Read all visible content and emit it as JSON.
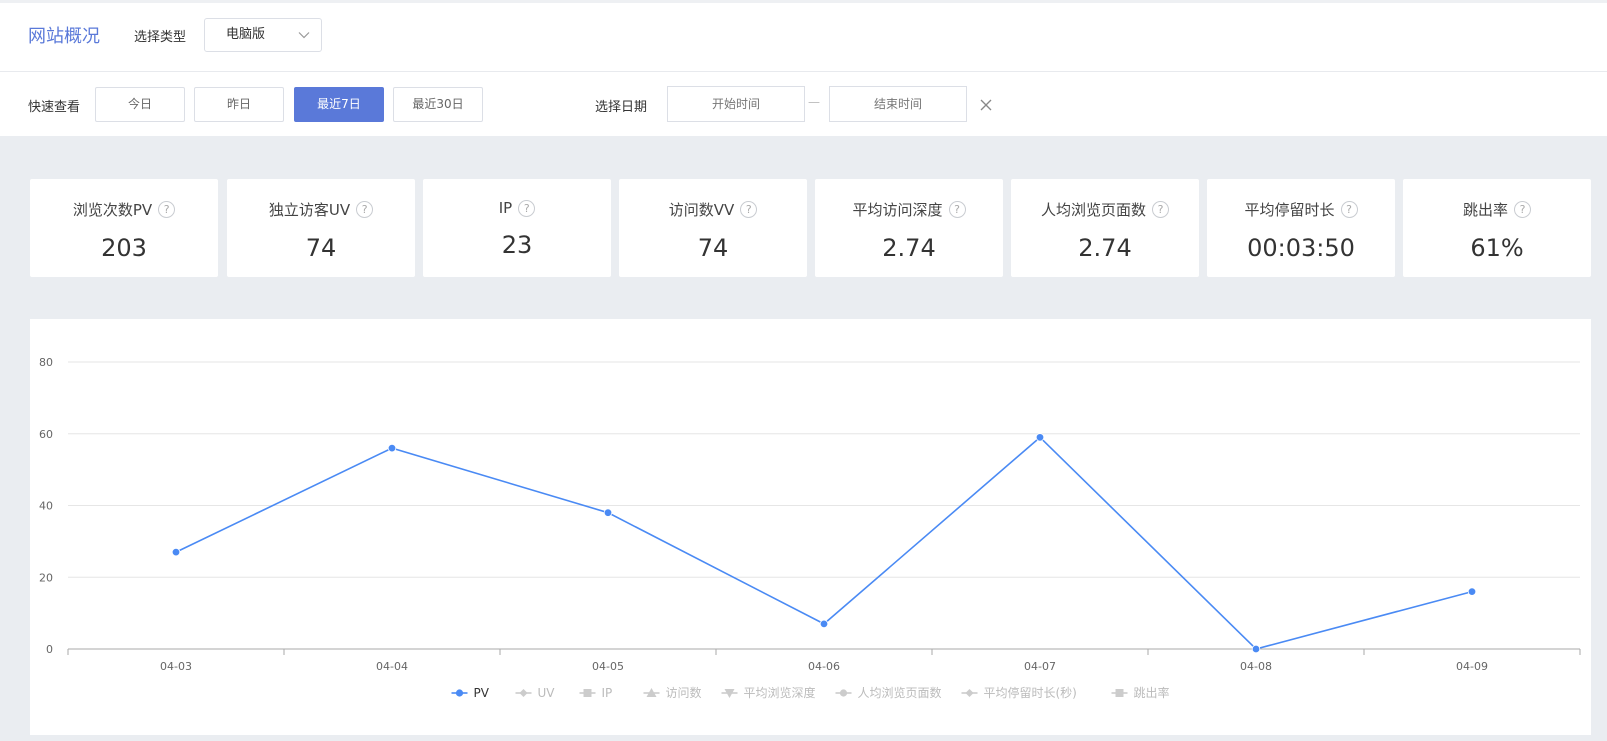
{
  "header": {
    "title": "网站概况",
    "type_label": "选择类型",
    "type_value": "电脑版"
  },
  "filter": {
    "quick_label": "快速查看",
    "buttons": [
      "今日",
      "昨日",
      "最近7日",
      "最近30日"
    ],
    "active_index": 2,
    "date_label": "选择日期",
    "start_placeholder": "开始时间",
    "end_placeholder": "结束时间",
    "separator": "—"
  },
  "stats": [
    {
      "label": "浏览次数PV",
      "value": "203"
    },
    {
      "label": "独立访客UV",
      "value": "74"
    },
    {
      "label": "IP",
      "value": "23"
    },
    {
      "label": "访问数VV",
      "value": "74"
    },
    {
      "label": "平均访问深度",
      "value": "2.74"
    },
    {
      "label": "人均浏览页面数",
      "value": "2.74"
    },
    {
      "label": "平均停留时长",
      "value": "00:03:50"
    },
    {
      "label": "跳出率",
      "value": "61%"
    }
  ],
  "help_symbol": "?",
  "colors": {
    "accent": "#5a79d9",
    "line": "#4a8af4",
    "legend_inactive": "#cccccc"
  },
  "chart_data": {
    "type": "line",
    "categories": [
      "04-03",
      "04-04",
      "04-05",
      "04-06",
      "04-07",
      "04-08",
      "04-09"
    ],
    "series": [
      {
        "name": "PV",
        "values": [
          27,
          56,
          38,
          7,
          59,
          0,
          16
        ],
        "active": true
      },
      {
        "name": "UV",
        "active": false
      },
      {
        "name": "IP",
        "active": false
      },
      {
        "name": "访问数",
        "active": false
      },
      {
        "name": "平均浏览深度",
        "active": false
      },
      {
        "name": "人均浏览页面数",
        "active": false
      },
      {
        "name": "平均停留时长(秒)",
        "active": false
      },
      {
        "name": "跳出率",
        "active": false
      }
    ],
    "ylim": [
      0,
      80
    ],
    "yticks": [
      0,
      20,
      40,
      60,
      80
    ],
    "grid": true,
    "legend_position": "bottom-center"
  }
}
